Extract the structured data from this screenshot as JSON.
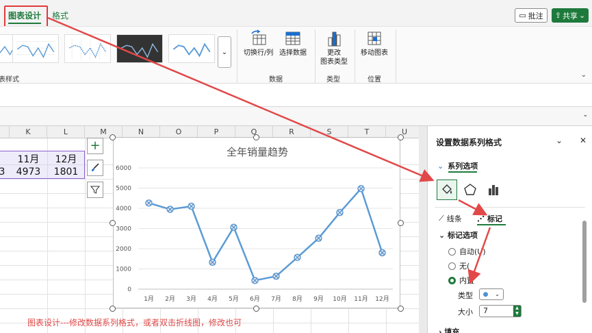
{
  "tabs": {
    "chart_design": "图表设计",
    "format": "格式"
  },
  "header_buttons": {
    "comment": "批注",
    "share": "共享"
  },
  "ribbon": {
    "chart_styles_label": "表样式",
    "switch_row_col": "切换行/列",
    "select_data": "选择数据",
    "data_group": "数据",
    "change_chart_type_line1": "更改",
    "change_chart_type_line2": "图表类型",
    "type_group": "类型",
    "move_chart": "移动图表",
    "location_group": "位置"
  },
  "sheet": {
    "columns": [
      "K",
      "L",
      "M",
      "N",
      "O",
      "P",
      "Q",
      "R",
      "S",
      "T",
      "U"
    ],
    "header_row": [
      "11月",
      "12月"
    ],
    "value_row": [
      "4973",
      "1801"
    ],
    "left_partial_value": "3"
  },
  "chart_data": {
    "type": "line",
    "title": "全年销量趋势",
    "categories": [
      "1月",
      "2月",
      "3月",
      "4月",
      "5月",
      "6月",
      "7月",
      "8月",
      "9月",
      "10月",
      "11月",
      "12月"
    ],
    "series": [
      {
        "values": [
          4260,
          3950,
          4100,
          1330,
          3060,
          430,
          640,
          1570,
          2520,
          3790,
          4973,
          1801
        ]
      }
    ],
    "ylim": [
      0,
      6000
    ],
    "yticks": [
      "0",
      "1000",
      "2000",
      "3000",
      "4000",
      "5000",
      "6000"
    ],
    "line_color": "#5b9bd5",
    "grid": true
  },
  "annotation": "图表设计---修改数据系列格式，或者双击折线图，修改也可",
  "pane": {
    "title": "设置数据系列格式",
    "series_options": "系列选项",
    "line_tab": "线条",
    "marker_tab": "标记",
    "marker_options": "标记选项",
    "auto": "自动(U)",
    "none": "无(",
    "builtin": "内置",
    "type_label": "类型",
    "size_label": "大小",
    "size_value": "7",
    "fill": "填充"
  },
  "colors": {
    "accent": "#1e7a3c",
    "annotation": "#e24848",
    "series": "#5b9bd5"
  }
}
